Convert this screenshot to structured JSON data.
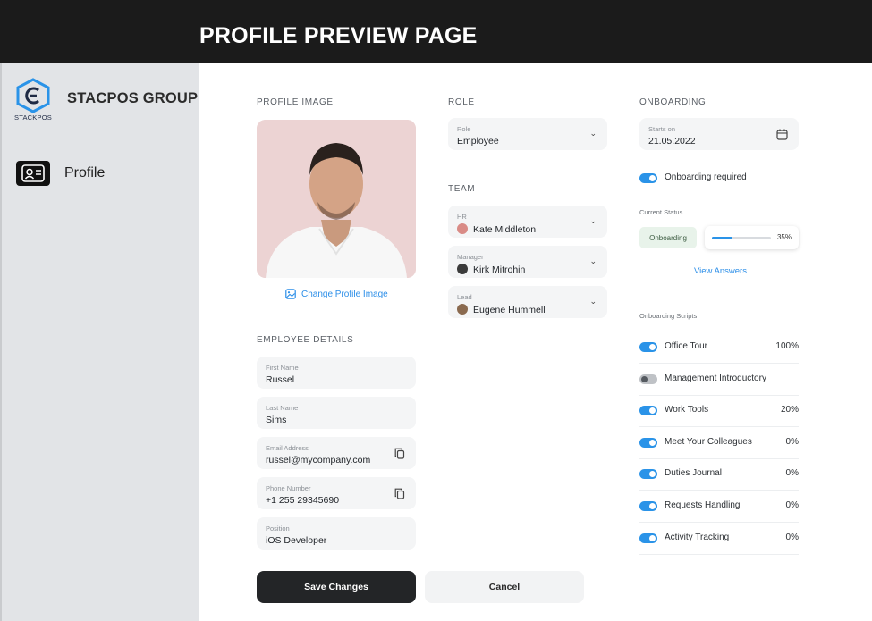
{
  "page_title": "PROFILE PREVIEW PAGE",
  "brand": {
    "name": "STACPOS GROUP",
    "logo_text": "STACKPOS"
  },
  "nav": {
    "profile_label": "Profile"
  },
  "profile_image": {
    "heading": "PROFILE IMAGE",
    "change_label": "Change Profile Image"
  },
  "employee": {
    "heading": "EMPLOYEE DETAILS",
    "first_name": {
      "label": "First Name",
      "value": "Russel"
    },
    "last_name": {
      "label": "Last Name",
      "value": "Sims"
    },
    "email": {
      "label": "Email Address",
      "value": "russel@mycompany.com"
    },
    "phone": {
      "label": "Phone Number",
      "value": "+1 255 29345690"
    },
    "position": {
      "label": "Position",
      "value": "iOS Developer"
    }
  },
  "role": {
    "heading": "ROLE",
    "label": "Role",
    "value": "Employee"
  },
  "team": {
    "heading": "TEAM",
    "hr": {
      "label": "HR",
      "value": "Kate Middleton"
    },
    "manager": {
      "label": "Manager",
      "value": "Kirk Mitrohin"
    },
    "lead": {
      "label": "Lead",
      "value": "Eugene Hummell"
    }
  },
  "onboarding": {
    "heading": "ONBOARDING",
    "starts_label": "Starts on",
    "starts_value": "21.05.2022",
    "required_label": "Onboarding required",
    "required_on": true,
    "status_label": "Current Status",
    "status_chip": "Onboarding",
    "progress_percent": 35,
    "progress_text": "35%",
    "view_answers": "View Answers",
    "scripts_label": "Onboarding Scripts",
    "scripts": [
      {
        "name": "Office Tour",
        "pct": "100%",
        "on": true
      },
      {
        "name": "Management Introductory",
        "pct": "",
        "on": false
      },
      {
        "name": "Work Tools",
        "pct": "20%",
        "on": true
      },
      {
        "name": "Meet Your Colleagues",
        "pct": "0%",
        "on": true
      },
      {
        "name": "Duties Journal",
        "pct": "0%",
        "on": true
      },
      {
        "name": "Requests Handling",
        "pct": "0%",
        "on": true
      },
      {
        "name": "Activity Tracking",
        "pct": "0%",
        "on": true
      }
    ]
  },
  "actions": {
    "save": "Save Changes",
    "cancel": "Cancel"
  },
  "colors": {
    "accent": "#2a93e8",
    "dark": "#232527",
    "sidebar": "#e2e4e7"
  }
}
